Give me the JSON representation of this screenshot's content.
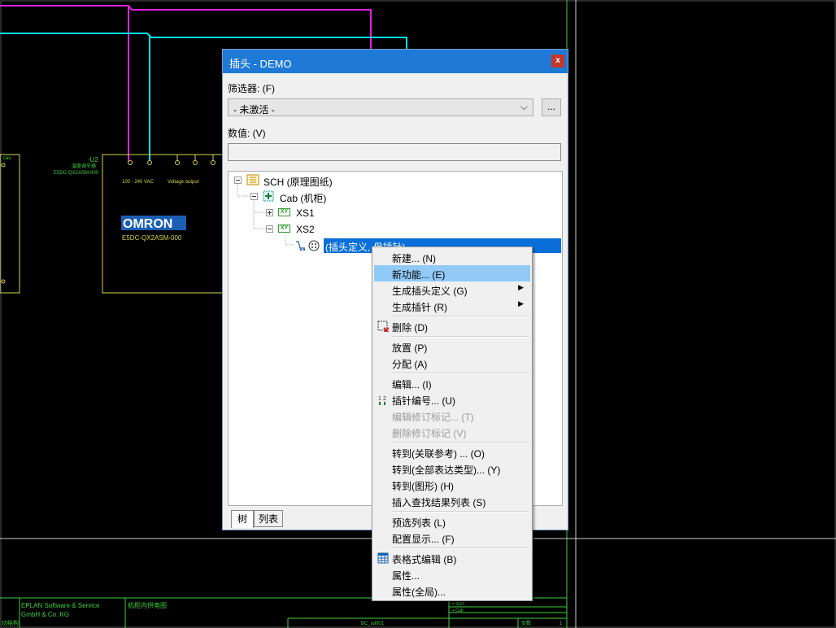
{
  "dialog": {
    "title": "插头 - DEMO",
    "close_label": "x",
    "filter_label": "筛选器: (F)",
    "filter_value": "- 未激活 -",
    "filter_more_label": "...",
    "value_label": "数值: (V)",
    "value_text": ""
  },
  "tree": {
    "root": "SCH (原理图纸)",
    "cab": "Cab (机柜)",
    "xs1": "XS1",
    "xs2": "XS2",
    "selected": "(插头定义, 母插针)",
    "xy_badge": "XY"
  },
  "tabs": [
    "树",
    "列表"
  ],
  "context_menu": {
    "items": [
      {
        "label": "新建... (N)"
      },
      {
        "label": "新功能... (E)",
        "highlighted": true
      },
      {
        "label": "生成插头定义 (G)",
        "submenu": true
      },
      {
        "label": "生成插针 (R)",
        "submenu": true
      },
      {
        "label": "删除 (D)",
        "icon": "delete-icon"
      },
      {
        "label": "放置 (P)"
      },
      {
        "label": "分配 (A)"
      },
      {
        "label": "编辑... (I)"
      },
      {
        "label": "插针编号... (U)",
        "icon": "pin-numbering-icon"
      },
      {
        "label": "编辑修订标记... (T)",
        "disabled": true
      },
      {
        "label": "删除修订标记 (V)",
        "disabled": true
      },
      {
        "label": "转到(关联参考) ... (O)"
      },
      {
        "label": "转到(全部表达类型)... (Y)"
      },
      {
        "label": "转到(图形) (H)"
      },
      {
        "label": "插入查找结果列表 (S)"
      },
      {
        "label": "预选列表 (L)"
      },
      {
        "label": "配置显示... (F)"
      },
      {
        "label": "表格式编辑 (B)",
        "icon": "table-icon"
      },
      {
        "label": "属性..."
      },
      {
        "label": "属性(全局)..."
      }
    ]
  },
  "schematic": {
    "device_tag": "-U2",
    "device_desc": "温度调节器",
    "device_part": "E5DC-QX2ASM-000",
    "supply_label": "100 - 240 VAC",
    "output_label": "Voltage output",
    "brand": "OMRON",
    "brand_part": "E5DC-QX2ASM-000",
    "left_device_tag": "-U1",
    "left_device_label": "cav",
    "title_block": {
      "company_line1": "EPLAN Software & Service",
      "company_line2": "GmbH & Co. KG",
      "drawing_title": "机柜内供电图",
      "function": "= SCH",
      "location": "+ Cab",
      "page_ref": "BC_sd001",
      "sheet_label": "页数",
      "sheet_num": "1",
      "left_label": "功结构"
    }
  },
  "colors": {
    "magenta_wire": "#e020e0",
    "cyan_wire": "#00e0f0",
    "frame_green": "#3ecf3e",
    "device_yellow": "#d6d64a",
    "title_blue": "#1e7ad6",
    "menu_highlight": "#91c9f7",
    "selection_blue": "#0a6fd8"
  }
}
